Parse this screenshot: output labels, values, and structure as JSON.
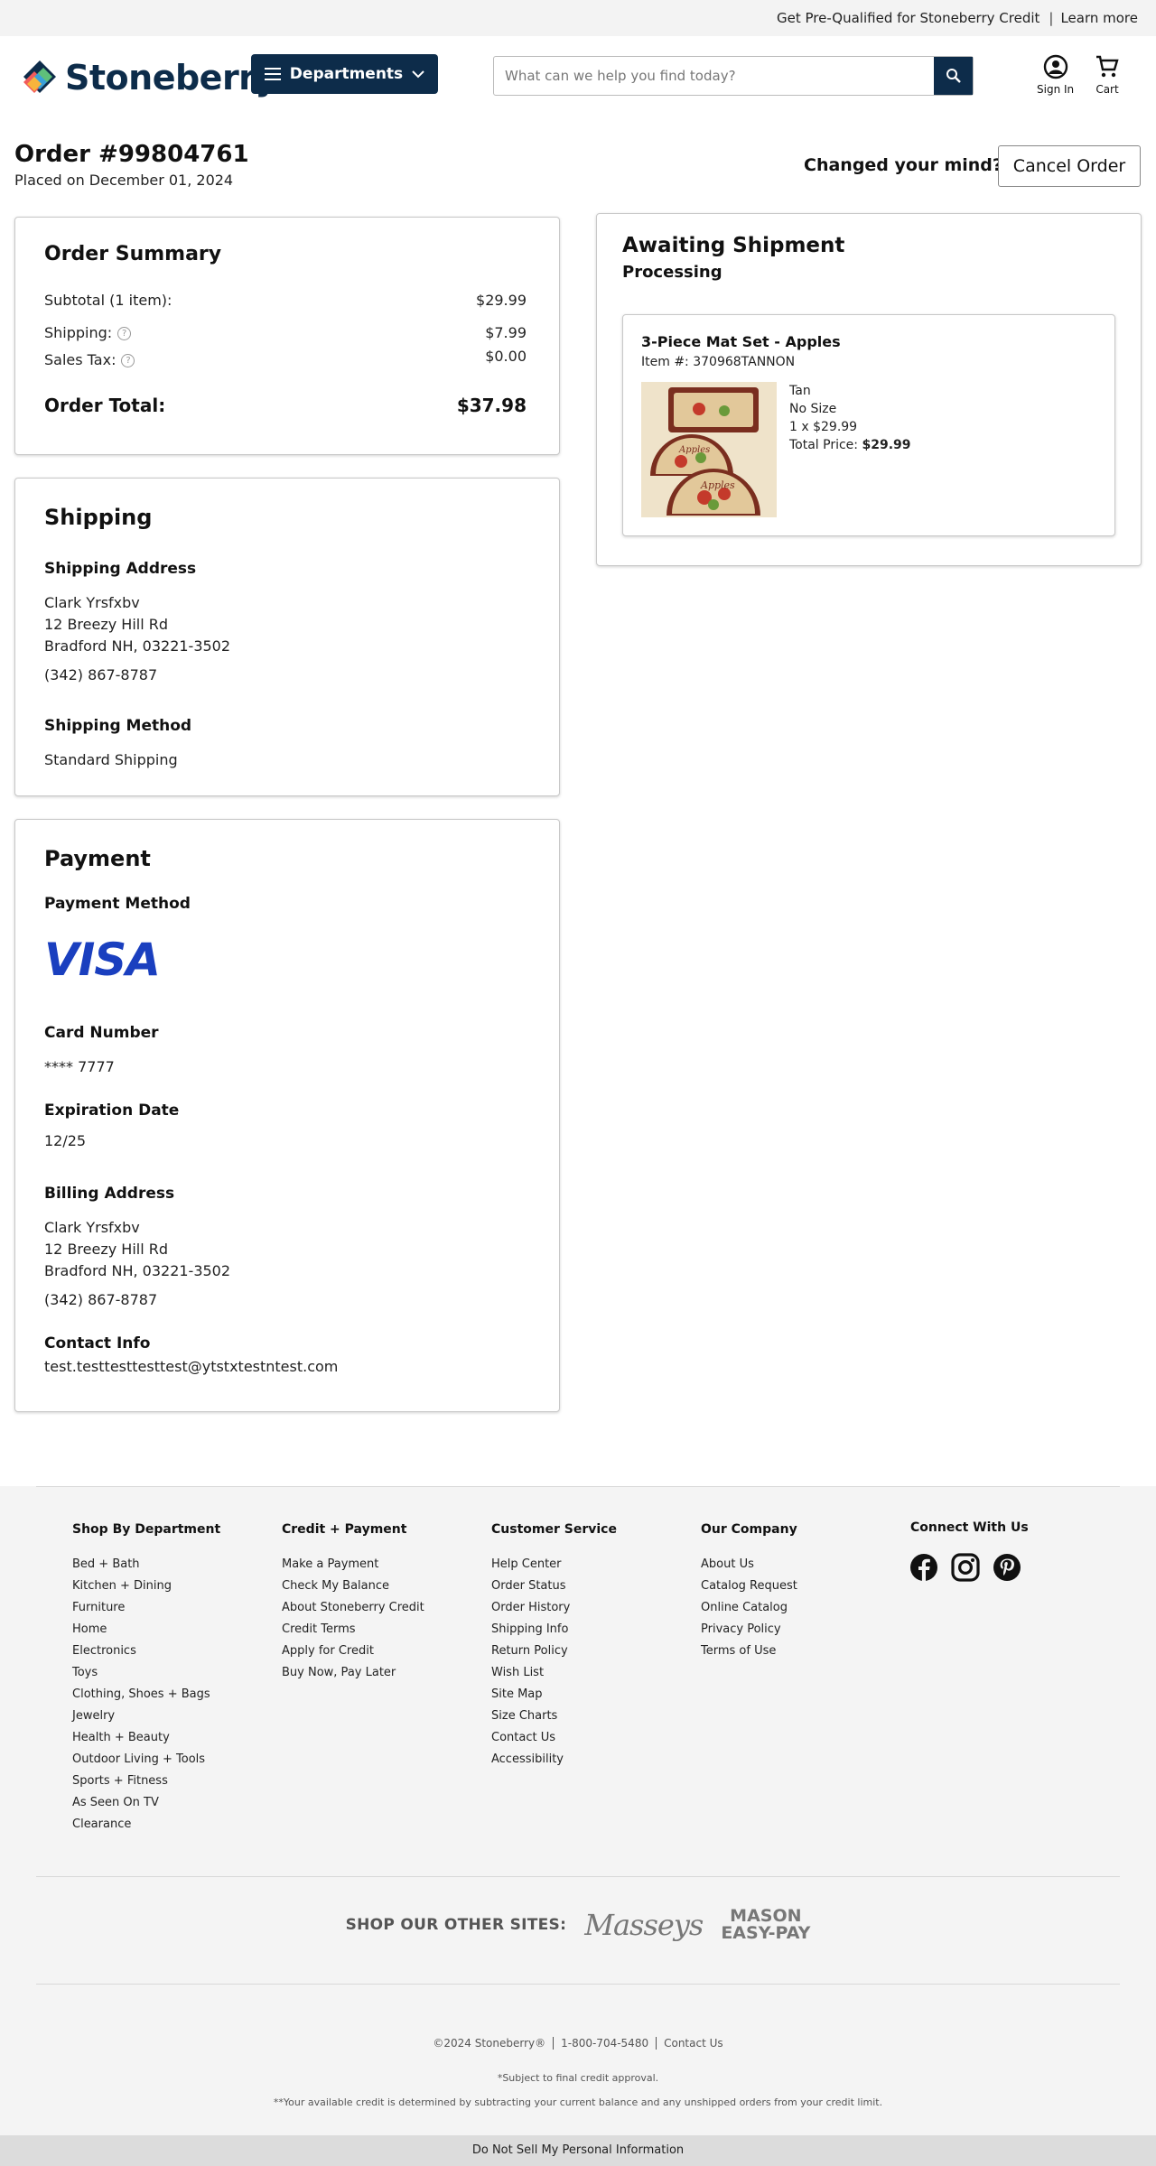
{
  "promo": {
    "text": "Get Pre-Qualified for Stoneberry Credit",
    "separator": "|",
    "link": "Learn more"
  },
  "header": {
    "logo_text": "Stoneberry",
    "departments_label": "Departments",
    "search_placeholder": "What can we help you find today?",
    "sign_in_label": "Sign In",
    "cart_label": "Cart"
  },
  "order": {
    "title": "Order #99804761",
    "placed": "Placed on December 01, 2024",
    "changed_mind": "Changed your mind?",
    "cancel_label": "Cancel Order"
  },
  "summary": {
    "title": "Order Summary",
    "subtotal_label": "Subtotal (1 item):",
    "subtotal_value": "$29.99",
    "shipping_label": "Shipping:",
    "shipping_value": "$7.99",
    "tax_label": "Sales Tax:",
    "tax_value": "$0.00",
    "total_label": "Order Total:",
    "total_value": "$37.98",
    "help_glyph": "?"
  },
  "shipping": {
    "title": "Shipping",
    "address_heading": "Shipping Address",
    "name": "Clark Yrsfxbv",
    "street": "12 Breezy Hill Rd",
    "city": "Bradford NH, 03221-3502",
    "phone": "(342) 867-8787",
    "method_heading": "Shipping Method",
    "method": "Standard Shipping"
  },
  "payment": {
    "title": "Payment",
    "method_heading": "Payment Method",
    "card_brand": "VISA",
    "card_number_heading": "Card Number",
    "card_number": "**** 7777",
    "expiration_heading": "Expiration Date",
    "expiration": "12/25",
    "billing_heading": "Billing Address",
    "billing_name": "Clark Yrsfxbv",
    "billing_street": "12 Breezy Hill Rd",
    "billing_city": "Bradford NH, 03221-3502",
    "billing_phone": "(342) 867-8787",
    "contact_heading": "Contact Info",
    "contact_email": "test.testtesttesttest@ytstxtestntest.com"
  },
  "shipment": {
    "status": "Awaiting Shipment",
    "substatus": "Processing",
    "item": {
      "name": "3-Piece Mat Set - Apples",
      "item_number": "Item #: 370968TANNON",
      "color": "Tan",
      "size": "No Size",
      "qty_price": "1 x $29.99",
      "total_label": "Total Price:",
      "total_value": "$29.99",
      "mat_text": "Apples"
    }
  },
  "footer": {
    "columns": [
      {
        "title": "Shop By Department",
        "links": [
          "Bed + Bath",
          "Kitchen + Dining",
          "Furniture",
          "Home",
          "Electronics",
          "Toys",
          "Clothing, Shoes + Bags",
          "Jewelry",
          "Health + Beauty",
          "Outdoor Living + Tools",
          "Sports + Fitness",
          "As Seen On TV",
          "Clearance"
        ]
      },
      {
        "title": "Credit + Payment",
        "links": [
          "Make a Payment",
          "Check My Balance",
          "About Stoneberry Credit",
          "Credit Terms",
          "Apply for Credit",
          "Buy Now, Pay Later"
        ]
      },
      {
        "title": "Customer Service",
        "links": [
          "Help Center",
          "Order Status",
          "Order History",
          "Shipping Info",
          "Return Policy",
          "Wish List",
          "Site Map",
          "Size Charts",
          "Contact Us",
          "Accessibility"
        ]
      },
      {
        "title": "Our Company",
        "links": [
          "About Us",
          "Catalog Request",
          "Online Catalog",
          "Privacy Policy",
          "Terms of Use"
        ]
      }
    ],
    "connect_title": "Connect With Us",
    "other_sites_label": "SHOP OUR OTHER SITES:",
    "masseys": "Masseys",
    "mason_line1": "MASON",
    "mason_line2": "EASY-PAY",
    "copyright": "©2024 Stoneberry®",
    "phone": "1-800-704-5480",
    "contact": "Contact Us",
    "note1": "*Subject to final credit approval.",
    "note2": "**Your available credit is determined by subtracting your current balance and any unshipped orders from your credit limit.",
    "do_not_sell": "Do Not Sell My Personal Information"
  },
  "colors": {
    "brand_navy": "#0d2c4a",
    "visa_blue": "#1a3fbf",
    "footer_bg": "#f4f4f4"
  }
}
